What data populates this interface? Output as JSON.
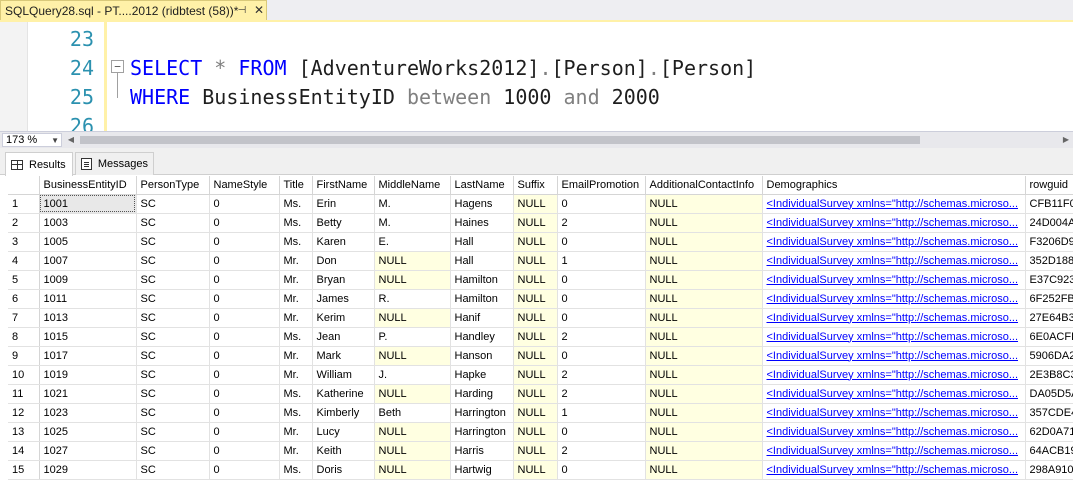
{
  "tab": {
    "title": "SQLQuery28.sql - PT....2012 (ridbtest (58))*",
    "pin_icon": "pin-icon",
    "close_icon": "close-icon"
  },
  "editor": {
    "lines": [
      {
        "num": "23",
        "tokens": []
      },
      {
        "num": "24",
        "tokens": [
          {
            "t": "SELECT",
            "c": "kw"
          },
          {
            "t": " ",
            "c": "txt"
          },
          {
            "t": "*",
            "c": "op"
          },
          {
            "t": " ",
            "c": "txt"
          },
          {
            "t": "FROM",
            "c": "kw"
          },
          {
            "t": " [AdventureWorks2012]",
            "c": "txt"
          },
          {
            "t": ".",
            "c": "op"
          },
          {
            "t": "[Person]",
            "c": "txt"
          },
          {
            "t": ".",
            "c": "op"
          },
          {
            "t": "[Person]",
            "c": "txt"
          }
        ]
      },
      {
        "num": "25",
        "tokens": [
          {
            "t": "WHERE",
            "c": "kw"
          },
          {
            "t": " BusinessEntityID ",
            "c": "txt"
          },
          {
            "t": "between",
            "c": "op"
          },
          {
            "t": " 1000 ",
            "c": "txt"
          },
          {
            "t": "and",
            "c": "op"
          },
          {
            "t": " 2000",
            "c": "txt"
          }
        ]
      },
      {
        "num": "26",
        "tokens": []
      }
    ],
    "fold_glyph": "−",
    "colors": {
      "keyword": "#0000ff",
      "operator": "#808080",
      "line_number": "#2b91af",
      "change_bar": "#fff1a8"
    }
  },
  "zoom": {
    "value": "173 %",
    "chevron_icon": "chevron-down-icon"
  },
  "results_tabs": [
    {
      "label": "Results",
      "icon": "grid-icon",
      "active": true
    },
    {
      "label": "Messages",
      "icon": "messages-icon",
      "active": false
    }
  ],
  "grid": {
    "columns": [
      "",
      "BusinessEntityID",
      "PersonType",
      "NameStyle",
      "Title",
      "FirstName",
      "MiddleName",
      "LastName",
      "Suffix",
      "EmailPromotion",
      "AdditionalContactInfo",
      "Demographics",
      "rowguid"
    ],
    "demographics_text": "<IndividualSurvey xmlns=\"http://schemas.microso...",
    "rows": [
      [
        "1",
        "1001",
        "SC",
        "0",
        "Ms.",
        "Erin",
        "M.",
        "Hagens",
        "NULL",
        "0",
        "NULL",
        "CFB11F0"
      ],
      [
        "2",
        "1003",
        "SC",
        "0",
        "Ms.",
        "Betty",
        "M.",
        "Haines",
        "NULL",
        "2",
        "NULL",
        "24D004A"
      ],
      [
        "3",
        "1005",
        "SC",
        "0",
        "Ms.",
        "Karen",
        "E.",
        "Hall",
        "NULL",
        "0",
        "NULL",
        "F3206D9"
      ],
      [
        "4",
        "1007",
        "SC",
        "0",
        "Mr.",
        "Don",
        "NULL",
        "Hall",
        "NULL",
        "1",
        "NULL",
        "352D188"
      ],
      [
        "5",
        "1009",
        "SC",
        "0",
        "Mr.",
        "Bryan",
        "NULL",
        "Hamilton",
        "NULL",
        "0",
        "NULL",
        "E37C923"
      ],
      [
        "6",
        "1011",
        "SC",
        "0",
        "Mr.",
        "James",
        "R.",
        "Hamilton",
        "NULL",
        "0",
        "NULL",
        "6F252FB"
      ],
      [
        "7",
        "1013",
        "SC",
        "0",
        "Mr.",
        "Kerim",
        "NULL",
        "Hanif",
        "NULL",
        "0",
        "NULL",
        "27E64B3"
      ],
      [
        "8",
        "1015",
        "SC",
        "0",
        "Ms.",
        "Jean",
        "P.",
        "Handley",
        "NULL",
        "2",
        "NULL",
        "6E0ACFF"
      ],
      [
        "9",
        "1017",
        "SC",
        "0",
        "Mr.",
        "Mark",
        "NULL",
        "Hanson",
        "NULL",
        "0",
        "NULL",
        "5906DA2"
      ],
      [
        "10",
        "1019",
        "SC",
        "0",
        "Mr.",
        "William",
        "J.",
        "Hapke",
        "NULL",
        "2",
        "NULL",
        "2E3B8C3"
      ],
      [
        "11",
        "1021",
        "SC",
        "0",
        "Ms.",
        "Katherine",
        "NULL",
        "Harding",
        "NULL",
        "2",
        "NULL",
        "DA05D5A"
      ],
      [
        "12",
        "1023",
        "SC",
        "0",
        "Ms.",
        "Kimberly",
        "Beth",
        "Harrington",
        "NULL",
        "1",
        "NULL",
        "357CDE4"
      ],
      [
        "13",
        "1025",
        "SC",
        "0",
        "Mr.",
        "Lucy",
        "NULL",
        "Harrington",
        "NULL",
        "0",
        "NULL",
        "62D0A71"
      ],
      [
        "14",
        "1027",
        "SC",
        "0",
        "Mr.",
        "Keith",
        "NULL",
        "Harris",
        "NULL",
        "2",
        "NULL",
        "64ACB19"
      ],
      [
        "15",
        "1029",
        "SC",
        "0",
        "Ms.",
        "Doris",
        "NULL",
        "Hartwig",
        "NULL",
        "0",
        "NULL",
        "298A910"
      ]
    ],
    "colors": {
      "null_bg": "#ffffe1",
      "link": "#0000ff"
    }
  }
}
